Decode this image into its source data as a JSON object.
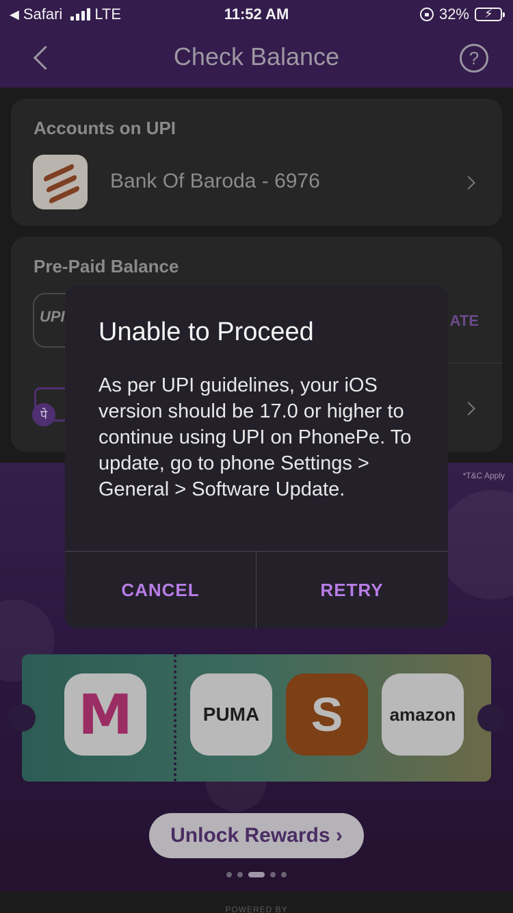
{
  "status_bar": {
    "carrier_back": "Safari",
    "network": "LTE",
    "time": "11:52 AM",
    "battery": "32%",
    "battery_level": 0.32
  },
  "nav": {
    "title": "Check Balance",
    "back_icon": "chevron-left-icon",
    "help_icon": "question-circle-icon"
  },
  "accounts": {
    "title": "Accounts on UPI",
    "bank": "Bank Of Baroda - 6976",
    "bank_icon": "bank-of-baroda-logo"
  },
  "prepaid": {
    "title": "Pre-Paid Balance",
    "upi_lite_action": "ATE",
    "wallet_icon": "phonepe-wallet-icon"
  },
  "promo": {
    "tnc": "*T&C Apply",
    "brands": [
      "Myntra",
      "PUMA",
      "Swiggy",
      "amazon"
    ],
    "cta": "Unlock Rewards ›",
    "active_dot": 3,
    "dots": 5
  },
  "footer": {
    "powered": "POWERED BY"
  },
  "dialog": {
    "title": "Unable to Proceed",
    "message": "As per UPI guidelines, your iOS version should be 17.0 or higher to continue using UPI on PhonePe. To update, go to phone Settings > General > Software Update.",
    "cancel": "CANCEL",
    "retry": "RETRY"
  },
  "colors": {
    "accent": "#b77de6",
    "header_bg": "#341c4d",
    "dialog_bg": "#23202a"
  }
}
